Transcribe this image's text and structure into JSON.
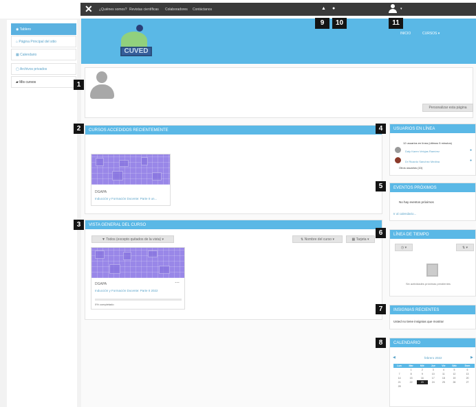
{
  "topbar": {
    "nav": [
      "¿Quiénes somos?",
      "Revistas científicas",
      "Colaboradores",
      "Contáctanos"
    ],
    "icons": [
      "close-icon",
      "bell-icon",
      "chat-icon",
      "user-icon",
      "caret-down-icon"
    ]
  },
  "markers": [
    "1",
    "2",
    "3",
    "4",
    "5",
    "6",
    "7",
    "8",
    "9",
    "10",
    "11"
  ],
  "sidebar": {
    "items": [
      {
        "label": "Tablero",
        "icon": "dashboard-icon"
      },
      {
        "label": "Página Principal del sitio",
        "icon": "home-icon"
      },
      {
        "label": "Calendario",
        "icon": "calendar-icon"
      },
      {
        "label": "Archivos privados",
        "icon": "file-icon"
      },
      {
        "label": "Mis cursos",
        "icon": "graduation-cap-icon"
      }
    ]
  },
  "banner": {
    "logo_text": "CUVED",
    "nav": [
      "INICIO",
      "CURSOS ▾"
    ]
  },
  "profile": {
    "customize_button": "Personalizar esta página"
  },
  "recent": {
    "title": "CURSOS ACCEDIDOS RECIENTEMENTE",
    "course": {
      "category": "DGAPA",
      "name": "Inducción y Formación Docente: Parte II un..."
    }
  },
  "overview": {
    "title": "VISTA GENERAL DEL CURSO",
    "filter": "Todos (excepto quitados de la vista) ▾",
    "sort": "Nombre del curso ▾",
    "view": "Tarjeta ▾",
    "course": {
      "category": "DGAPA",
      "name": "Inducción y Formación Docente: Parte II 2022",
      "progress": "0% completado",
      "progress_value": 0
    }
  },
  "online": {
    "title": "USUARIOS EN LÍNEA",
    "summary": "12 usuarios en línea (últimos 5 minutos)",
    "users": [
      "Daly Karen Velujas Ramírez",
      "Dr Ricardo Sánchez Medina"
    ],
    "others": "Otros usuarios (10)"
  },
  "events": {
    "title": "EVENTOS PRÓXIMOS",
    "empty": "No hay eventos próximos",
    "link": "Ir al calendario..."
  },
  "timeline": {
    "title": "LÍNEA DE TIEMPO",
    "empty": "Sin actividades próximas pendientes"
  },
  "badges": {
    "title": "INSIGNIAS RECIENTES",
    "empty": "Usted no tiene insignias que mostrar"
  },
  "calendar": {
    "title": "CALENDARIO",
    "month": "febrero 2022",
    "days": [
      "Lun",
      "Mar",
      "Mié",
      "Jue",
      "Vie",
      "Sáb",
      "Dom"
    ],
    "weeks": [
      [
        "",
        "1",
        "2",
        "3",
        "4",
        "5",
        "6"
      ],
      [
        "7",
        "8",
        "9",
        "10",
        "11",
        "12",
        "13"
      ],
      [
        "14",
        "15",
        "16",
        "17",
        "18",
        "19",
        "20"
      ],
      [
        "21",
        "22",
        "23",
        "24",
        "25",
        "26",
        "27"
      ],
      [
        "28",
        "",
        "",
        "",
        "",
        "",
        ""
      ]
    ],
    "today": "23"
  }
}
